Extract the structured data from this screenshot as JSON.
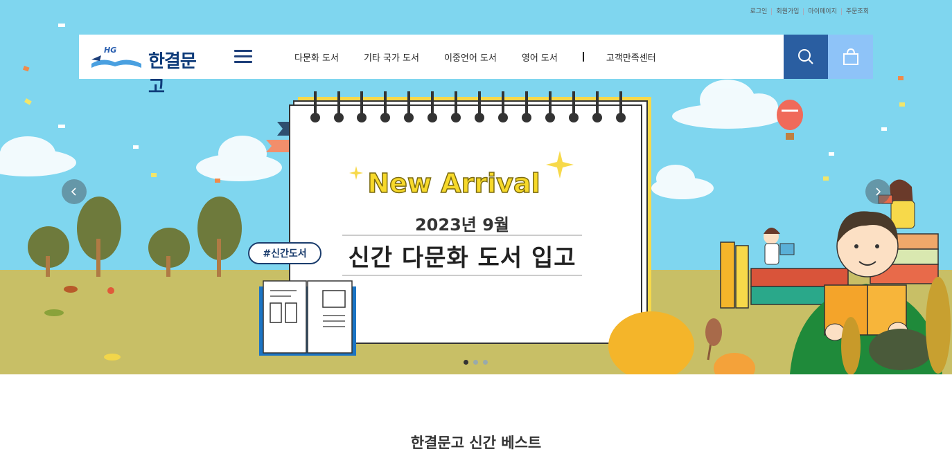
{
  "utility_links": [
    "로그인",
    "회원가입",
    "마이페이지",
    "주문조회"
  ],
  "logo": {
    "mark": "HG",
    "text": "한결문고"
  },
  "nav": {
    "items": [
      "다문화 도서",
      "기타 국가 도서",
      "이중언어 도서",
      "영어 도서"
    ],
    "extra": "고객만족센터"
  },
  "icons": {
    "menu": "hamburger-icon",
    "search": "search-icon",
    "cart": "shopping-bag-icon",
    "prev": "chevron-left-icon",
    "next": "chevron-right-icon"
  },
  "banner": {
    "headline": "New Arrival",
    "date": "2023년 9월",
    "title": "신간 다문화 도서 입고",
    "tag": "#신간도서"
  },
  "pager": {
    "total": 3,
    "active": 1
  },
  "section": {
    "title": "한결문고 신간 베스트"
  },
  "colors": {
    "sky": "#7fd6ef",
    "ground": "#c8bf66",
    "search_button": "#2a5ea1",
    "cart_button": "#8ec3f8",
    "brand": "#0f3c7a"
  }
}
